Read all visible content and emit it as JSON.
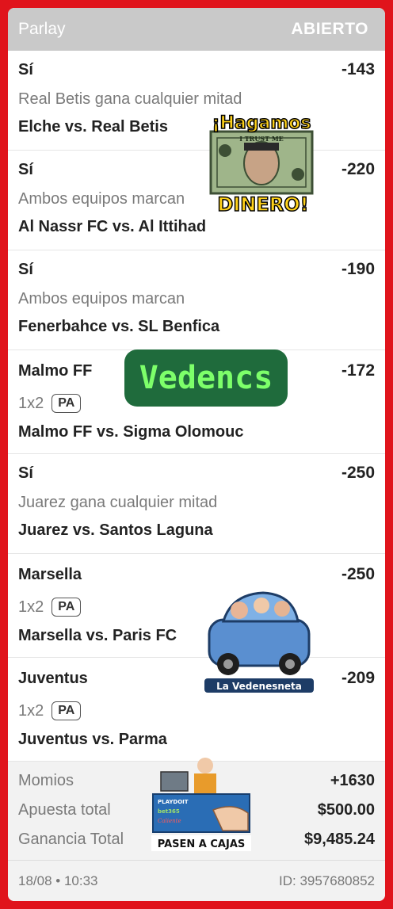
{
  "header": {
    "title": "Parlay",
    "status": "ABIERTO"
  },
  "legs": [
    {
      "selection": "Sí",
      "odds": "-143",
      "market": "Real Betis gana cualquier mitad",
      "match": "Elche vs. Real Betis"
    },
    {
      "selection": "Sí",
      "odds": "-220",
      "market": "Ambos equipos marcan",
      "match": "Al Nassr FC vs. Al Ittihad"
    },
    {
      "selection": "Sí",
      "odds": "-190",
      "market": "Ambos equipos marcan",
      "match": "Fenerbahce vs. SL Benfica"
    },
    {
      "selection": "Malmo FF",
      "odds": "-172",
      "market": "1x2",
      "badge": "PA",
      "match": "Malmo FF vs. Sigma Olomouc"
    },
    {
      "selection": "Sí",
      "odds": "-250",
      "market": "Juarez gana cualquier mitad",
      "match": "Juarez vs. Santos Laguna"
    },
    {
      "selection": "Marsella",
      "odds": "-250",
      "market": "1x2",
      "badge": "PA",
      "match": "Marsella vs. Paris FC"
    },
    {
      "selection": "Juventus",
      "odds": "-209",
      "market": "1x2",
      "badge": "PA",
      "match": "Juventus vs. Parma"
    }
  ],
  "totals": {
    "momios_label": "Momios",
    "momios_value": "+1630",
    "stake_label": "Apuesta total",
    "stake_value": "$500.00",
    "win_label": "Ganancia Total",
    "win_value": "$9,485.24"
  },
  "footer": {
    "date": "18/08 • 10:33",
    "id": "ID: 3957680852"
  },
  "stickers": {
    "money_top": "¡Hagamos",
    "money_bottom": "DINERO!",
    "money_bill_text": "I TRUST ME",
    "vedencs": "Vedencs",
    "car_caption": "La Vedenesneta",
    "cash_caption": "PASEN A CAJAS",
    "cash_brands": [
      "PLAYDOIT",
      "bet365",
      "Caliente"
    ]
  },
  "colors": {
    "frame": "#e0141c",
    "header": "#c9c9c9",
    "vedencs_bg": "#1f6b3c",
    "vedencs_text": "#7dff6a"
  }
}
